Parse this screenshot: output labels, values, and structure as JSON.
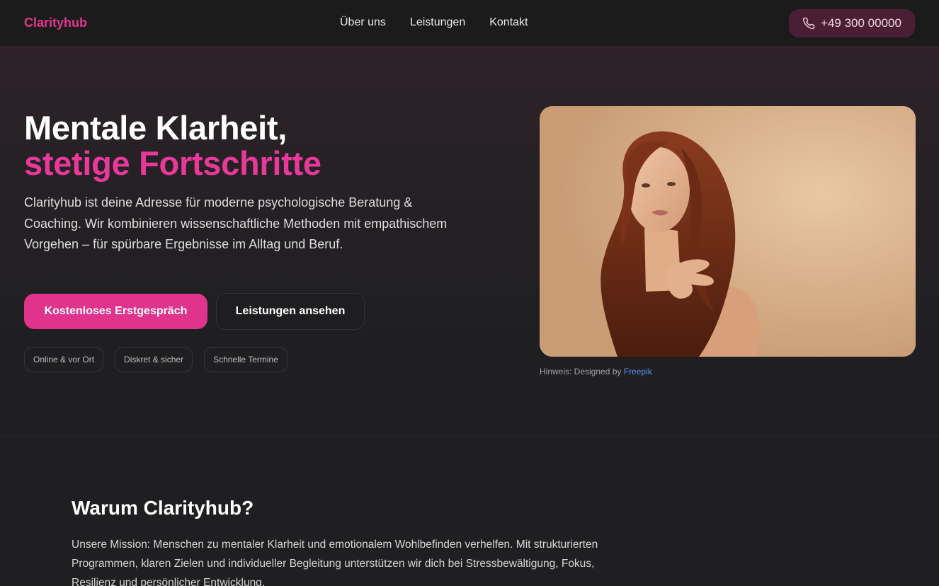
{
  "header": {
    "logo": "Clarityhub",
    "nav": [
      {
        "label": "Über uns"
      },
      {
        "label": "Leistungen"
      },
      {
        "label": "Kontakt"
      }
    ],
    "phone": "+49 300 00000",
    "phone_icon": "phone-icon"
  },
  "hero": {
    "title_line1": "Mentale Klarheit,",
    "title_line2": "stetige Fortschritte",
    "lead": "Clarityhub ist deine Adresse für moderne psychologische Beratung & Coaching. Wir kombinieren wissenschaftliche Methoden mit empathischem Vorgehen – für spürbare Ergebnisse im Alltag und Beruf.",
    "primary_button": "Kostenloses Erstgespräch",
    "secondary_button": "Leistungen ansehen",
    "tags": [
      "Online & vor Ort",
      "Diskret & sicher",
      "Schnelle Termine"
    ],
    "credit_prefix": "Hinweis: Designed by",
    "credit_link": "Freepik"
  },
  "about": {
    "title": "Warum Clarityhub?",
    "text": "Unsere Mission: Menschen zu mentaler Klarheit und emotionalem Wohlbefinden verhelfen. Mit strukturierten Programmen, klaren Zielen und individueller Begleitung unterstützen wir dich bei Stressbewältigung, Fokus, Resilienz und persönlicher Entwicklung."
  },
  "colors": {
    "accent": "#e0338b",
    "background": "#1f1f21"
  }
}
